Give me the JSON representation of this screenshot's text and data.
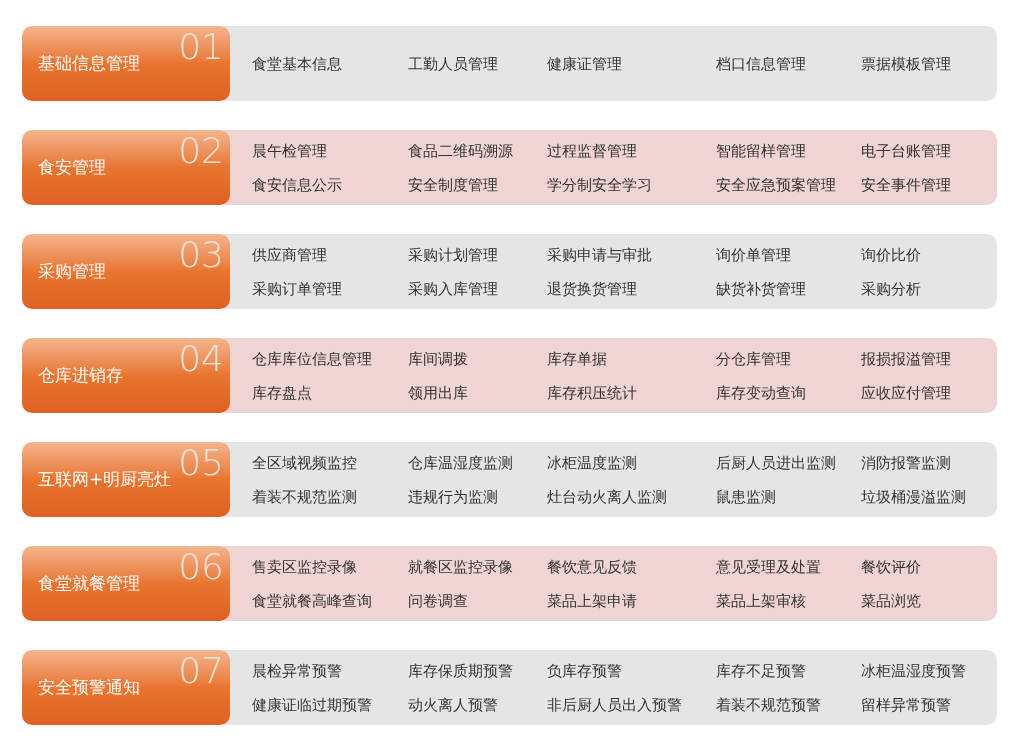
{
  "modules": [
    {
      "number": "01",
      "title": "基础信息管理",
      "color": "#e6e5e6",
      "rows": [
        [
          "食堂基本信息",
          "工勤人员管理",
          "健康证管理",
          "档口信息管理",
          "票据模板管理"
        ]
      ]
    },
    {
      "number": "02",
      "title": "食安管理",
      "color": "#efd4d3",
      "rows": [
        [
          "晨午检管理",
          "食品二维码溯源",
          "过程监督管理",
          "智能留样管理",
          "电子台账管理"
        ],
        [
          "食安信息公示",
          "安全制度管理",
          "学分制安全学习",
          "安全应急预案管理",
          "安全事件管理"
        ]
      ]
    },
    {
      "number": "03",
      "title": "采购管理",
      "color": "#e6e5e6",
      "rows": [
        [
          "供应商管理",
          "采购计划管理",
          "采购申请与审批",
          "询价单管理",
          "询价比价"
        ],
        [
          "采购订单管理",
          "采购入库管理",
          "退货换货管理",
          "缺货补货管理",
          "采购分析"
        ]
      ]
    },
    {
      "number": "04",
      "title": "仓库进销存",
      "color": "#efd4d3",
      "rows": [
        [
          "仓库库位信息管理",
          "库间调拨",
          "库存单据",
          "分仓库管理",
          "报损报溢管理"
        ],
        [
          "库存盘点",
          "领用出库",
          "库存积压统计",
          "库存变动查询",
          "应收应付管理"
        ]
      ]
    },
    {
      "number": "05",
      "title": "互联网+明厨亮灶",
      "color": "#e6e5e6",
      "rows": [
        [
          "全区域视频监控",
          "仓库温湿度监测",
          "冰柜温度监测",
          "后厨人员进出监测",
          "消防报警监测"
        ],
        [
          "着装不规范监测",
          "违规行为监测",
          "灶台动火离人监测",
          "鼠患监测",
          "垃圾桶漫溢监测"
        ]
      ]
    },
    {
      "number": "06",
      "title": "食堂就餐管理",
      "color": "#efd4d3",
      "rows": [
        [
          "售卖区监控录像",
          "就餐区监控录像",
          "餐饮意见反馈",
          "意见受理及处置",
          "餐饮评价"
        ],
        [
          "食堂就餐高峰查询",
          "问卷调查",
          "菜品上架申请",
          "菜品上架审核",
          "菜品浏览"
        ]
      ]
    },
    {
      "number": "07",
      "title": "安全预警通知",
      "color": "#e6e5e6",
      "rows": [
        [
          "晨检异常预警",
          "库存保质期预警",
          "负库存预警",
          "库存不足预警",
          "冰柜温湿度预警"
        ],
        [
          "健康证临过期预警",
          "动火离人预警",
          "非后厨人员出入预警",
          "着装不规范预警",
          "留样异常预警"
        ]
      ]
    }
  ]
}
